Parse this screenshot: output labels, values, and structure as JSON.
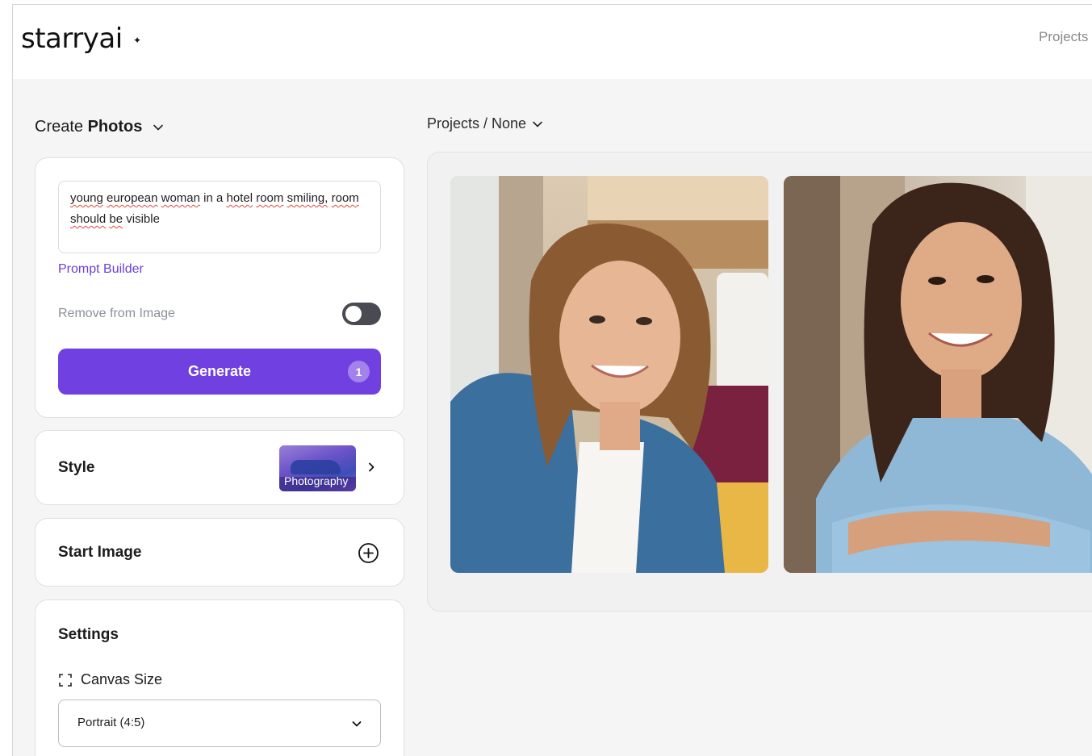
{
  "app": {
    "logo": "starryai",
    "logo_mark": "✦"
  },
  "topnav": {
    "projects_label": "Projects"
  },
  "create": {
    "prefix": "Create",
    "mode": "Photos"
  },
  "prompt": {
    "text_words": [
      {
        "t": "young",
        "sq": true
      },
      {
        "t": " ",
        "sq": false
      },
      {
        "t": "european",
        "sq": true
      },
      {
        "t": " ",
        "sq": false
      },
      {
        "t": "woman",
        "sq": true
      },
      {
        "t": " in a ",
        "sq": false
      },
      {
        "t": "hotel",
        "sq": true
      },
      {
        "t": " ",
        "sq": false
      },
      {
        "t": "room",
        "sq": true
      },
      {
        "t": " ",
        "sq": false
      },
      {
        "t": "smiling,",
        "sq": true
      },
      {
        "t": " ",
        "sq": false
      },
      {
        "t": "room",
        "sq": true
      },
      {
        "t": " ",
        "sq": false
      },
      {
        "t": "should",
        "sq": true
      },
      {
        "t": " ",
        "sq": false
      },
      {
        "t": "be",
        "sq": true
      },
      {
        "t": " visible",
        "sq": false
      }
    ],
    "builder_link": "Prompt Builder",
    "remove_label": "Remove from Image",
    "remove_enabled": false,
    "generate_label": "Generate",
    "generate_count": "1"
  },
  "style": {
    "label": "Style",
    "selected": "Photography"
  },
  "start_image": {
    "label": "Start Image"
  },
  "settings": {
    "label": "Settings",
    "canvas_size_label": "Canvas Size",
    "canvas_size_value": "Portrait (4:5)"
  },
  "breadcrumb": {
    "text": "Projects / None"
  },
  "gallery": {
    "images": [
      {
        "name": "generated-image-1"
      },
      {
        "name": "generated-image-2"
      }
    ]
  },
  "colors": {
    "accent": "#7040e0",
    "link": "#6a3fd7",
    "toggle_off": "#4a4a52"
  }
}
